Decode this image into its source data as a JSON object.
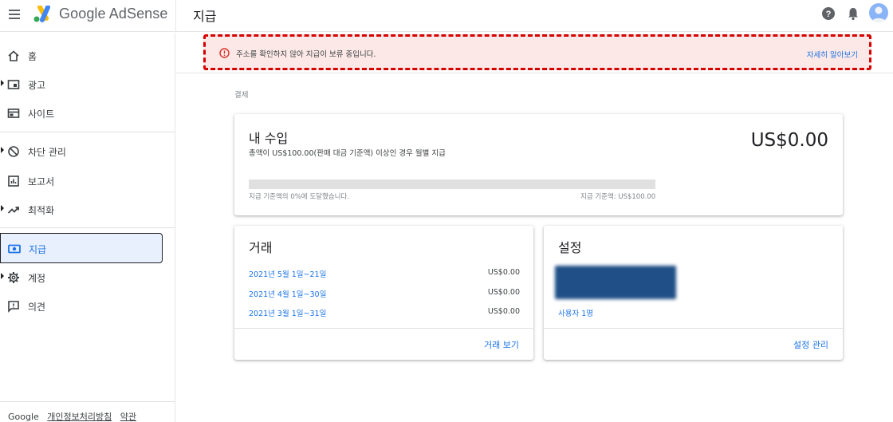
{
  "app": {
    "brand": "Google AdSense",
    "page_title": "지급"
  },
  "sidebar": {
    "items": [
      {
        "label": "홈",
        "icon": "home-icon",
        "has_arrow": false
      },
      {
        "label": "광고",
        "icon": "ads-icon",
        "has_arrow": true
      },
      {
        "label": "사이트",
        "icon": "sites-icon",
        "has_arrow": false
      },
      {
        "label": "차단 관리",
        "icon": "block-icon",
        "has_arrow": true
      },
      {
        "label": "보고서",
        "icon": "reports-icon",
        "has_arrow": false
      },
      {
        "label": "최적화",
        "icon": "trending-icon",
        "has_arrow": true
      },
      {
        "label": "지급",
        "icon": "payments-icon",
        "has_arrow": false,
        "active": true
      },
      {
        "label": "계정",
        "icon": "gear-icon",
        "has_arrow": true
      },
      {
        "label": "의견",
        "icon": "feedback-icon",
        "has_arrow": false
      }
    ],
    "footer": {
      "google": "Google",
      "privacy": "개인정보처리방침",
      "terms": "약관"
    }
  },
  "alert": {
    "message": "주소를 확인하지 않아 지급이 보류 중입니다.",
    "link": "자세히 알아보기"
  },
  "section_label": "결제",
  "earnings": {
    "title": "내 수입",
    "subtitle": "총액이 US$100.00(판매 대금 기준액) 이상인 경우 월별 지급",
    "amount": "US$0.00",
    "progress_percent": 0,
    "progress_left": "지급 기준액의 0%에 도달했습니다.",
    "progress_right": "지급 기준액: US$100.00"
  },
  "transactions": {
    "title": "거래",
    "rows": [
      {
        "period": "2021년 5월 1일~21일",
        "amount": "US$0.00"
      },
      {
        "period": "2021년 4월 1일~30일",
        "amount": "US$0.00"
      },
      {
        "period": "2021년 3월 1일~31일",
        "amount": "US$0.00"
      }
    ],
    "footer_link": "거래 보기"
  },
  "settings": {
    "title": "설정",
    "users_link": "사용자 1명",
    "footer_link": "설정 관리"
  },
  "colors": {
    "accent": "#1a73e8",
    "alert_bg": "#fce8e6",
    "alert_border": "#d50000",
    "active_bg": "#e8f0fe"
  }
}
